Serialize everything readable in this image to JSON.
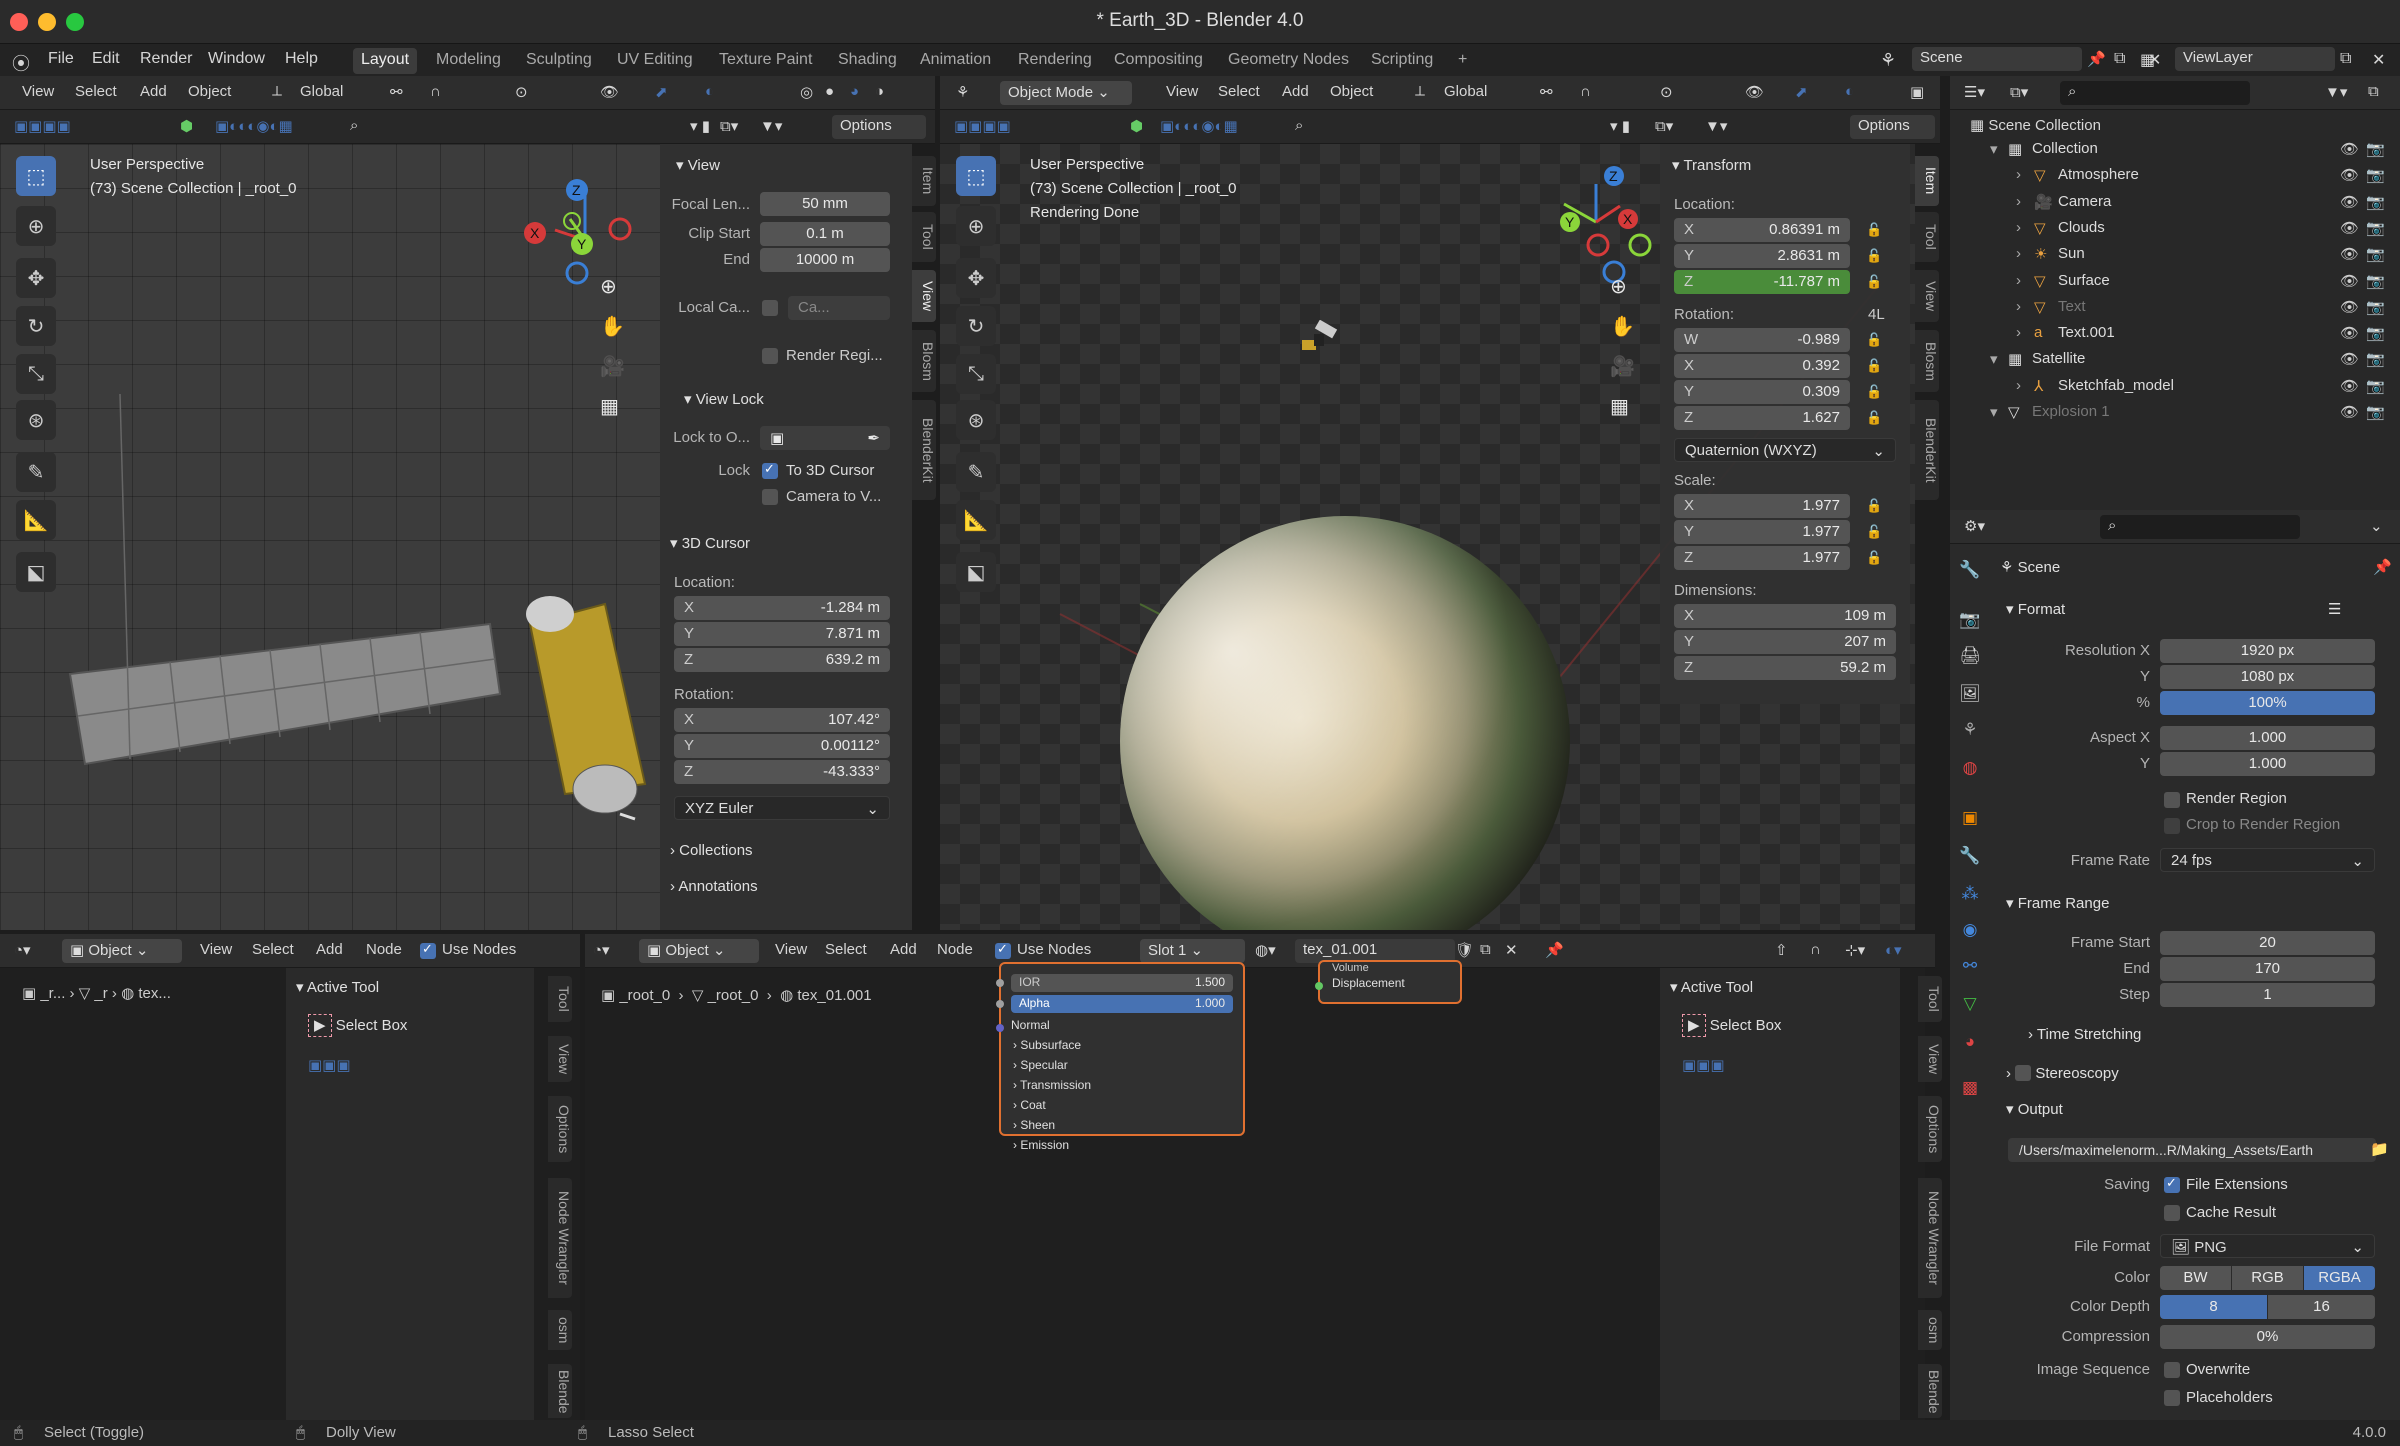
{
  "window": {
    "title": "* Earth_3D - Blender 4.0"
  },
  "menu": [
    "File",
    "Edit",
    "Render",
    "Window",
    "Help"
  ],
  "workspaces": [
    "Layout",
    "Modeling",
    "Sculpting",
    "UV Editing",
    "Texture Paint",
    "Shading",
    "Animation",
    "Rendering",
    "Compositing",
    "Geometry Nodes",
    "Scripting",
    "+"
  ],
  "scene": {
    "name": "Scene",
    "view_layer": "ViewLayer"
  },
  "vp1": {
    "menu": [
      "View",
      "Select",
      "Add",
      "Object"
    ],
    "transform": "Global",
    "options": "Options",
    "overlay_line1": "User Perspective",
    "overlay_line2": "(73) Scene Collection | _root_0",
    "tabs": [
      "Item",
      "Tool",
      "View",
      "Blosm",
      "BlenderKit"
    ],
    "view": {
      "title": "View",
      "focal_label": "Focal Len...",
      "focal": "50 mm",
      "clip_start_label": "Clip Start",
      "clip_start": "0.1 m",
      "end_label": "End",
      "clip_end": "10000 m",
      "local_cam_label": "Local Ca...",
      "local_cam": "Ca...",
      "render_region": "Render Regi..."
    },
    "view_lock": {
      "title": "View Lock",
      "lock_to_label": "Lock to O...",
      "lock_label": "Lock",
      "to_cursor": "To 3D Cursor",
      "camera_to": "Camera to V..."
    },
    "cursor": {
      "title": "3D Cursor",
      "location_label": "Location:",
      "x": "-1.284 m",
      "y": "7.871 m",
      "z": "639.2 m",
      "rotation_label": "Rotation:",
      "rx": "107.42°",
      "ry": "0.00112°",
      "rz": "-43.333°",
      "mode": "XYZ Euler"
    },
    "collections": "Collections",
    "annotations": "Annotations"
  },
  "vp2": {
    "mode": "Object Mode",
    "menu": [
      "View",
      "Select",
      "Add",
      "Object"
    ],
    "transform": "Global",
    "options": "Options",
    "overlay_line1": "User Perspective",
    "overlay_line2": "(73) Scene Collection | _root_0",
    "overlay_line3": "Rendering Done",
    "tabs": [
      "Item",
      "Tool",
      "View",
      "Blosm",
      "BlenderKit"
    ],
    "transform_panel": {
      "title": "Transform",
      "location_label": "Location:",
      "lx": "0.86391 m",
      "ly": "2.8631 m",
      "lz": "-11.787 m",
      "rotation_label": "Rotation:",
      "rot_flag": "4L",
      "w": "-0.989",
      "rx": "0.392",
      "ry": "0.309",
      "rz": "1.627",
      "mode": "Quaternion (WXYZ)",
      "scale_label": "Scale:",
      "sx": "1.977",
      "sy": "1.977",
      "sz": "1.977",
      "dims_label": "Dimensions:",
      "dx": "109 m",
      "dy": "207 m",
      "dz": "59.2 m"
    }
  },
  "axes": {
    "x": "X",
    "y": "Y",
    "z": "Z",
    "w": "W"
  },
  "outliner": {
    "root": "Scene Collection",
    "items": [
      {
        "name": "Collection",
        "indent": 0,
        "dim": false
      },
      {
        "name": "Atmosphere",
        "indent": 1,
        "dim": false
      },
      {
        "name": "Camera",
        "indent": 1,
        "dim": false
      },
      {
        "name": "Clouds",
        "indent": 1,
        "dim": false
      },
      {
        "name": "Sun",
        "indent": 1,
        "dim": false
      },
      {
        "name": "Surface",
        "indent": 1,
        "dim": false
      },
      {
        "name": "Text",
        "indent": 1,
        "dim": true
      },
      {
        "name": "Text.001",
        "indent": 1,
        "dim": false
      },
      {
        "name": "Satellite",
        "indent": 0,
        "dim": false
      },
      {
        "name": "Sketchfab_model",
        "indent": 1,
        "dim": false
      },
      {
        "name": "Explosion 1",
        "indent": 0,
        "dim": true
      }
    ]
  },
  "props": {
    "scene": "Scene",
    "format": {
      "title": "Format",
      "resx_label": "Resolution X",
      "resx": "1920 px",
      "resy_label": "Y",
      "resy": "1080 px",
      "pct_label": "%",
      "pct": "100%",
      "aspx_label": "Aspect X",
      "aspx": "1.000",
      "aspy_label": "Y",
      "aspy": "1.000",
      "render_region": "Render Region",
      "crop": "Crop to Render Region",
      "fps_label": "Frame Rate",
      "fps": "24 fps"
    },
    "frame_range": {
      "title": "Frame Range",
      "start_label": "Frame Start",
      "start": "20",
      "end_label": "End",
      "end": "170",
      "step_label": "Step",
      "step": "1",
      "time_stretching": "Time Stretching"
    },
    "stereoscopy": "Stereoscopy",
    "output": {
      "title": "Output",
      "path": "/Users/maximelenorm...R/Making_Assets/Earth",
      "saving_label": "Saving",
      "file_ext": "File Extensions",
      "cache": "Cache Result",
      "format_label": "File Format",
      "format": "PNG",
      "color_label": "Color",
      "color_opts": [
        "BW",
        "RGB",
        "RGBA"
      ],
      "depth_label": "Color Depth",
      "depth_opts": [
        "8",
        "16"
      ],
      "compression_label": "Compression",
      "compression": "0%",
      "imgseq_label": "Image Sequence",
      "overwrite": "Overwrite",
      "placeholders": "Placeholders"
    }
  },
  "ne1": {
    "type": "Object",
    "menu": [
      "View",
      "Select",
      "Add",
      "Node"
    ],
    "use_nodes": "Use Nodes",
    "crumbs": [
      "_r...",
      "_r",
      "tex..."
    ],
    "active_tool": "Active Tool",
    "select_box": "Select Box",
    "tabs": [
      "Tool",
      "View",
      "Options",
      "Node Wrangler",
      "osm",
      "Blende"
    ]
  },
  "ne2": {
    "type": "Object",
    "menu": [
      "View",
      "Select",
      "Add",
      "Node"
    ],
    "use_nodes": "Use Nodes",
    "slot": "Slot 1",
    "material": "tex_01.001",
    "crumbs": [
      "_root_0",
      "_root_0",
      "tex_01.001"
    ],
    "node": {
      "ior_label": "IOR",
      "ior": "1.500",
      "alpha_label": "Alpha",
      "alpha": "1.000",
      "normal": "Normal",
      "subs": [
        "Subsurface",
        "Specular",
        "Transmission",
        "Coat",
        "Sheen",
        "Emission"
      ]
    },
    "output_node": {
      "volume": "Volume",
      "displacement": "Displacement"
    },
    "active_tool": "Active Tool",
    "select_box": "Select Box",
    "tabs": [
      "Tool",
      "View",
      "Options",
      "Node Wrangler",
      "osm",
      "Blende"
    ]
  },
  "status": {
    "select": "Select (Toggle)",
    "dolly": "Dolly View",
    "lasso": "Lasso Select",
    "version": "4.0.0"
  },
  "colors": {
    "accent": "#4772b3",
    "node_border": "#e07030",
    "grn": "#4a8c3a"
  }
}
